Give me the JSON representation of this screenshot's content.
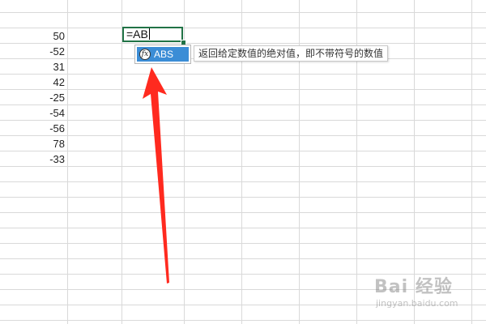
{
  "sheet": {
    "column_values": [
      "50",
      "-52",
      "31",
      "42",
      "-25",
      "-54",
      "-56",
      "78",
      "-33"
    ],
    "active_cell_text": "=AB"
  },
  "autocomplete": {
    "suggestion": "ABS",
    "icon": "fx-icon",
    "icon_glyph": "fx"
  },
  "tooltip": {
    "text": "返回给定数值的绝对值，即不带符号的数值"
  },
  "annotation": {
    "arrow_color": "#ff2a1f"
  },
  "watermark": {
    "main": "Bai 经验",
    "sub": "jingyan.baidu.com"
  },
  "colors": {
    "selection_border": "#217346",
    "suggestion_highlight": "#3b8dd6",
    "gridline": "#d9d9d9"
  }
}
